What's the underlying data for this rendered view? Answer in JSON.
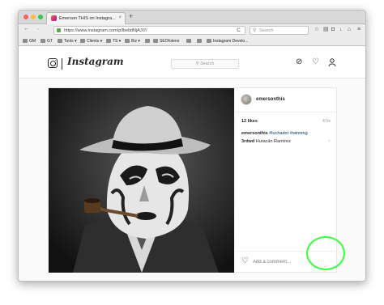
{
  "browser": {
    "tab_title": "Emerson THIS on Instagra...",
    "tab_close": "×",
    "new_tab": "+",
    "nav_back": "←",
    "nav_forward": "→",
    "url": "https://www.instagram.com/p/lbeltdNjAJt7/",
    "reload": "C",
    "search_placeholder": "Search",
    "traffic_lights": [
      "#fc605c",
      "#fdbc40",
      "#34c84a"
    ]
  },
  "bookmarks": [
    "GM",
    "GT",
    "Tools",
    "Clients",
    "TS",
    "Biz",
    "",
    "SEOfoteno",
    "",
    "",
    "Instagram Develo..."
  ],
  "instagram": {
    "wordmark": "Instagram",
    "search_placeholder": "Search",
    "post": {
      "username": "emersonthis",
      "likes": "12 likes",
      "age": "47w",
      "caption_user": "emersonthis",
      "caption_tags": "#luchador #winning",
      "comment_user": "3rdwd",
      "comment_text": "Huracán Ramírez",
      "comment_delete": "×",
      "add_comment_placeholder": "Add a comment...",
      "more_label": "···"
    }
  },
  "colors": {
    "link": "#003569",
    "highlight": "#39ff3f"
  }
}
